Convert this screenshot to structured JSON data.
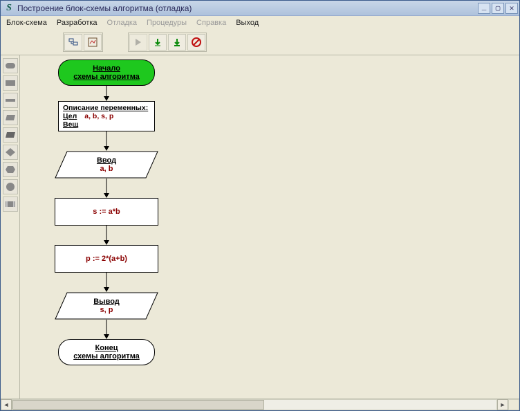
{
  "window": {
    "app_icon": "S",
    "title": "Построение блок-схемы алгоритма (отладка)"
  },
  "menu": {
    "items": [
      {
        "label": "Блок-схема",
        "enabled": true
      },
      {
        "label": "Разработка",
        "enabled": true
      },
      {
        "label": "Отладка",
        "enabled": false
      },
      {
        "label": "Процедуры",
        "enabled": false
      },
      {
        "label": "Справка",
        "enabled": false
      },
      {
        "label": "Выход",
        "enabled": true
      }
    ]
  },
  "toolbar": {
    "group1": [
      {
        "name": "step-into",
        "enabled": true
      },
      {
        "name": "chart-view",
        "enabled": true
      }
    ],
    "group2": [
      {
        "name": "run",
        "enabled": false
      },
      {
        "name": "step-over",
        "enabled": true
      },
      {
        "name": "step-down",
        "enabled": true
      },
      {
        "name": "stop",
        "enabled": true
      }
    ]
  },
  "palette": [
    {
      "name": "terminal-shape"
    },
    {
      "name": "process-shape"
    },
    {
      "name": "rect-flat-shape"
    },
    {
      "name": "io-shape"
    },
    {
      "name": "io-shape-2"
    },
    {
      "name": "decision-shape"
    },
    {
      "name": "loop-shape"
    },
    {
      "name": "connector-shape"
    },
    {
      "name": "subroutine-shape"
    }
  ],
  "flowchart": {
    "start": {
      "line1": "Начало",
      "line2": "схемы алгоритма"
    },
    "declare": {
      "header": "Описание переменных:",
      "int_kw": "Цел",
      "int_vars": "a, b, s, p",
      "real_kw": "Вещ"
    },
    "input": {
      "title": "Ввод",
      "vars": "a, b"
    },
    "proc1": "s := a*b",
    "proc2": "p := 2*(a+b)",
    "output": {
      "title": "Вывод",
      "vars": "s, p"
    },
    "end": {
      "line1": "Конец",
      "line2": "схемы алгоритма"
    }
  }
}
